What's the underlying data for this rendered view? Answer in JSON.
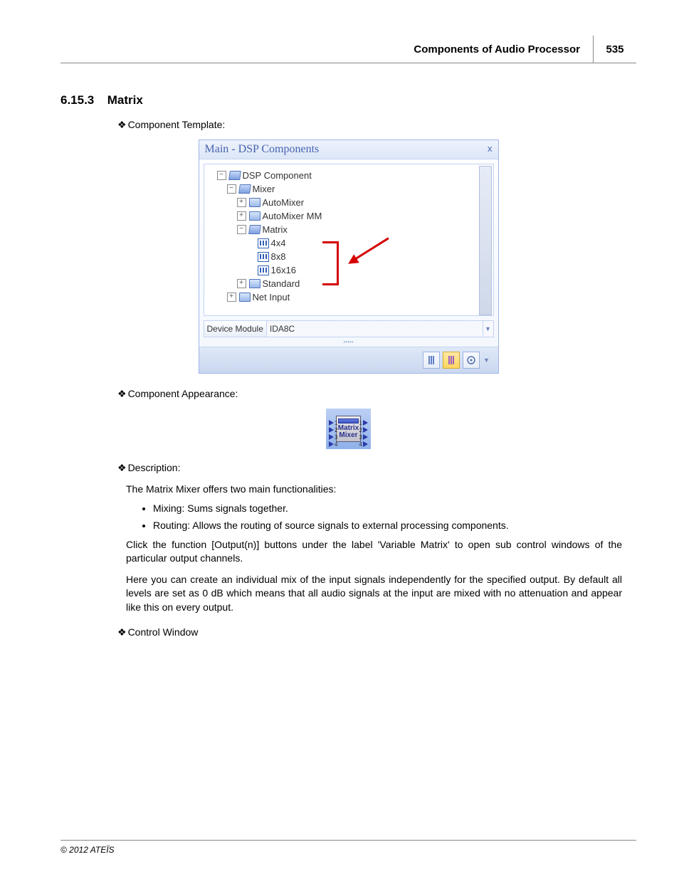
{
  "header": {
    "title": "Components of Audio Processor",
    "page": "535"
  },
  "section": {
    "number": "6.15.3",
    "title": "Matrix"
  },
  "labels": {
    "component_template": "Component Template:",
    "component_appearance": "Component Appearance:",
    "description": "Description:",
    "control_window": "Control Window"
  },
  "window": {
    "title": "Main - DSP Components",
    "close": "x",
    "device_module_label": "Device Module",
    "device_module_value": "IDA8C"
  },
  "tree": {
    "root": "DSP Component",
    "mixer": "Mixer",
    "automixer": "AutoMixer",
    "automixer_mm": "AutoMixer MM",
    "matrix": "Matrix",
    "m4": "4x4",
    "m8": "8x8",
    "m16": "16x16",
    "standard": "Standard",
    "net_input": "Net Input"
  },
  "chip": {
    "line1": "Matrix",
    "line2": "Mixer",
    "pins": [
      "1",
      "2",
      "3",
      "4"
    ]
  },
  "description": {
    "intro": "The Matrix Mixer offers two main functionalities:",
    "mixing": "Mixing: Sums signals together.",
    "routing": "Routing: Allows the routing of source signals to external processing components.",
    "p1": "Click the function [Output(n)] buttons under the label 'Variable Matrix'  to open sub control windows of the particular output channels.",
    "p2": "Here you can create an individual mix of the input signals independently for the specified output. By default all levels are set as 0 dB which means that all audio signals at the input are mixed with no attenuation and appear like this on every output."
  },
  "footer": {
    "copyright": "© 2012 ATEÏS"
  }
}
